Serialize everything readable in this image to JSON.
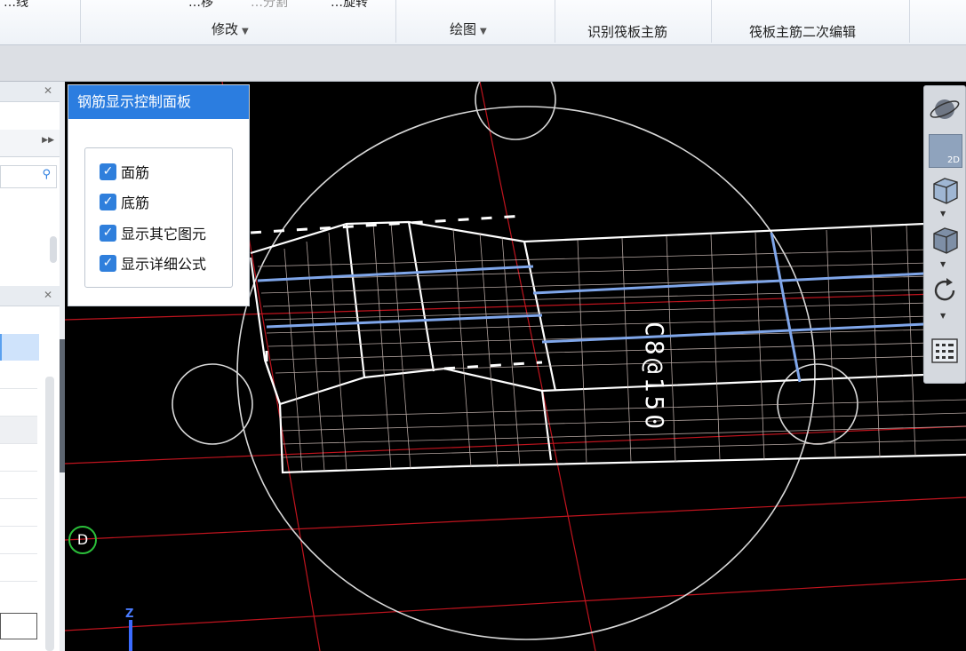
{
  "ribbon": {
    "top_partial_items": [
      "…线",
      "…移",
      "…分割",
      "…旋转"
    ],
    "groups": [
      {
        "label": "修改",
        "dropdown": true
      },
      {
        "label": "绘图",
        "dropdown": true
      },
      {
        "label": "识别筏板主筋",
        "dropdown": false
      },
      {
        "label": "筏板主筋二次编辑",
        "dropdown": false
      }
    ]
  },
  "panel": {
    "title": "钢筋显示控制面板",
    "options": [
      {
        "label": "面筋",
        "checked": true
      },
      {
        "label": "底筋",
        "checked": true
      },
      {
        "label": "显示其它图元",
        "checked": true
      },
      {
        "label": "显示详细公式",
        "checked": true
      }
    ],
    "check_mark": "✓"
  },
  "viewport": {
    "axis_label": "D",
    "slab_annotation": "C8@150",
    "z_label": "Z"
  },
  "toolbar": {
    "twod_label": "2D",
    "icons": [
      "orbit-icon",
      "2d-view-icon",
      "box-wireframe-icon",
      "box-solid-icon",
      "rotate-icon",
      "layer-list-icon"
    ]
  },
  "colors": {
    "panel_accent": "#2b7de0",
    "rebar_blue": "#7fa6ea",
    "grid_red": "#c0141e",
    "wire_white": "#ffffff"
  }
}
